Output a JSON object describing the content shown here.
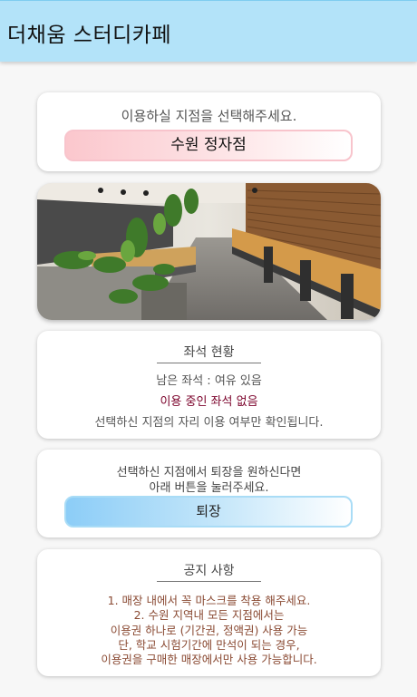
{
  "app": {
    "title": "더채움 스터디카페"
  },
  "branch": {
    "prompt": "이용하실 지점을 선택해주세요.",
    "selected": "수원 정자점"
  },
  "seats": {
    "heading": "좌석 현황",
    "remaining": "남은 좌석 : 여유 있음",
    "in_use": "이용 중인 좌석 없음",
    "note": "선택하신 지점의 자리 이용 여부만 확인됩니다."
  },
  "checkout": {
    "message_line1": "선택하신 지점에서 퇴장을 원하신다면",
    "message_line2": "아래 버튼을 눌러주세요.",
    "button_label": "퇴장"
  },
  "notice": {
    "heading": "공지 사항",
    "lines": [
      "1. 매장 내에서 꼭 마스크를 착용 해주세요.",
      "2. 수원 지역내 모든 지점에서는",
      "이용권 하나로 (기간권, 정액권) 사용 가능",
      "단, 학교 시험기간에 만석이 되는 경우,",
      "이용권을 구매한 매장에서만 사용 가능합니다."
    ]
  },
  "colors": {
    "appbar": "#b3e3f9",
    "branch_button": "#fbc7cd",
    "checkout_button": "#8ccdf7",
    "in_use_text": "#7a0029",
    "notice_text": "#8a4a33"
  }
}
